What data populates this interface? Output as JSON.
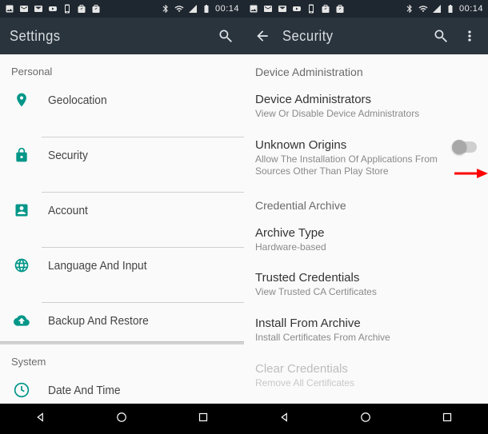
{
  "status": {
    "time": "00:14"
  },
  "left": {
    "title": "Settings",
    "sections": {
      "personal": {
        "header": "Personal"
      },
      "system": {
        "header": "System"
      }
    },
    "items": {
      "geo": "Geolocation",
      "security": "Security",
      "account": "Account",
      "lang": "Language And Input",
      "backup": "Backup And Restore",
      "datetime": "Date And Time"
    }
  },
  "right": {
    "title": "Security",
    "headers": {
      "devadmin": "Device Administration",
      "credarchive": "Credential Archive"
    },
    "items": {
      "devadmins": {
        "title": "Device Administrators",
        "sub": "View Or Disable Device Administrators"
      },
      "unknown": {
        "title": "Unknown Origins",
        "sub": "Allow The Installation Of Applications From Sources Other Than Play Store"
      },
      "archtype": {
        "title": "Archive Type",
        "sub": "Hardware-based"
      },
      "trusted": {
        "title": "Trusted Credentials",
        "sub": "View Trusted CA Certificates"
      },
      "install": {
        "title": "Install From Archive",
        "sub": "Install Certificates From Archive"
      },
      "clear": {
        "title": "Clear Credentials",
        "sub": "Remove All Certificates"
      }
    }
  }
}
